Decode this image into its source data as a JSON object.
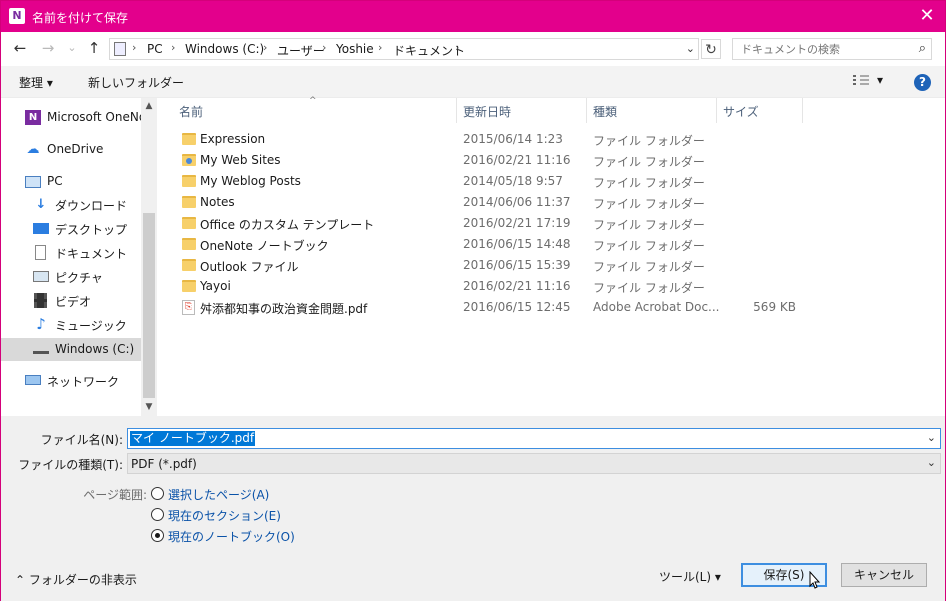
{
  "window": {
    "app_icon": "N",
    "title": "名前を付けて保存",
    "close_glyph": "✕",
    "accent_color": "#e3008c"
  },
  "nav_bar": {
    "back_glyph": "←",
    "forward_glyph": "→",
    "recent_glyph": "⌄",
    "up_glyph": "↑",
    "breadcrumbs": [
      "PC",
      "Windows (C:)",
      "ユーザー",
      "Yoshie",
      "ドキュメント"
    ],
    "crumb_separator": "›",
    "refresh_glyph": "↻",
    "search_placeholder": "ドキュメントの検索"
  },
  "toolbar": {
    "organize_label": "整理 ▾",
    "new_folder_label": "新しいフォルダー",
    "view_dropdown_glyph": "▾",
    "help_label": "?"
  },
  "sidebar": {
    "items": [
      {
        "label": "Microsoft OneNote",
        "icon": "onenote-icon"
      },
      {
        "label": "OneDrive",
        "icon": "onedrive-icon"
      },
      {
        "label": "PC",
        "icon": "pc-icon"
      },
      {
        "label": "ダウンロード",
        "icon": "download-icon"
      },
      {
        "label": "デスクトップ",
        "icon": "desktop-icon"
      },
      {
        "label": "ドキュメント",
        "icon": "documents-icon"
      },
      {
        "label": "ピクチャ",
        "icon": "pictures-icon"
      },
      {
        "label": "ビデオ",
        "icon": "videos-icon"
      },
      {
        "label": "ミュージック",
        "icon": "music-icon"
      },
      {
        "label": "Windows (C:)",
        "icon": "drive-icon",
        "selected": true
      },
      {
        "label": "ネットワーク",
        "icon": "network-icon"
      }
    ],
    "scroll_up_glyph": "▲",
    "scroll_down_glyph": "▼"
  },
  "file_list": {
    "columns": [
      "名前",
      "更新日時",
      "種類",
      "サイズ"
    ],
    "sort_glyph": "^",
    "rows": [
      {
        "name": "Expression",
        "modified": "2015/06/14 1:23",
        "type": "ファイル フォルダー",
        "size": "",
        "icon": "folder-icon"
      },
      {
        "name": "My Web Sites",
        "modified": "2016/02/21 11:16",
        "type": "ファイル フォルダー",
        "size": "",
        "icon": "web-folder-icon"
      },
      {
        "name": "My Weblog Posts",
        "modified": "2014/05/18 9:57",
        "type": "ファイル フォルダー",
        "size": "",
        "icon": "folder-icon"
      },
      {
        "name": "Notes",
        "modified": "2014/06/06 11:37",
        "type": "ファイル フォルダー",
        "size": "",
        "icon": "folder-icon"
      },
      {
        "name": "Office のカスタム テンプレート",
        "modified": "2016/02/21 17:19",
        "type": "ファイル フォルダー",
        "size": "",
        "icon": "folder-icon"
      },
      {
        "name": "OneNote ノートブック",
        "modified": "2016/06/15 14:48",
        "type": "ファイル フォルダー",
        "size": "",
        "icon": "folder-icon"
      },
      {
        "name": "Outlook ファイル",
        "modified": "2016/06/15 15:39",
        "type": "ファイル フォルダー",
        "size": "",
        "icon": "folder-icon"
      },
      {
        "name": "Yayoi",
        "modified": "2016/02/21 11:16",
        "type": "ファイル フォルダー",
        "size": "",
        "icon": "folder-icon"
      },
      {
        "name": "舛添都知事の政治資金問題.pdf",
        "modified": "2016/06/15 12:45",
        "type": "Adobe Acrobat Doc...",
        "size": "569 KB",
        "icon": "pdf-icon"
      }
    ]
  },
  "form": {
    "filename_label": "ファイル名(N):",
    "filename_value": "マイ ノートブック.pdf",
    "filetype_label": "ファイルの種類(T):",
    "filetype_value": "PDF (*.pdf)",
    "dropdown_glyph": "⌄",
    "page_range_label": "ページ範囲:",
    "radio_options": [
      {
        "label": "選択したページ(A)",
        "checked": false
      },
      {
        "label": "現在のセクション(E)",
        "checked": false
      },
      {
        "label": "現在のノートブック(O)",
        "checked": true
      }
    ]
  },
  "footer": {
    "hide_folders_label": "⌃  フォルダーの非表示",
    "tools_label": "ツール(L)    ▾",
    "save_label": "保存(S)",
    "cancel_label": "キャンセル"
  }
}
